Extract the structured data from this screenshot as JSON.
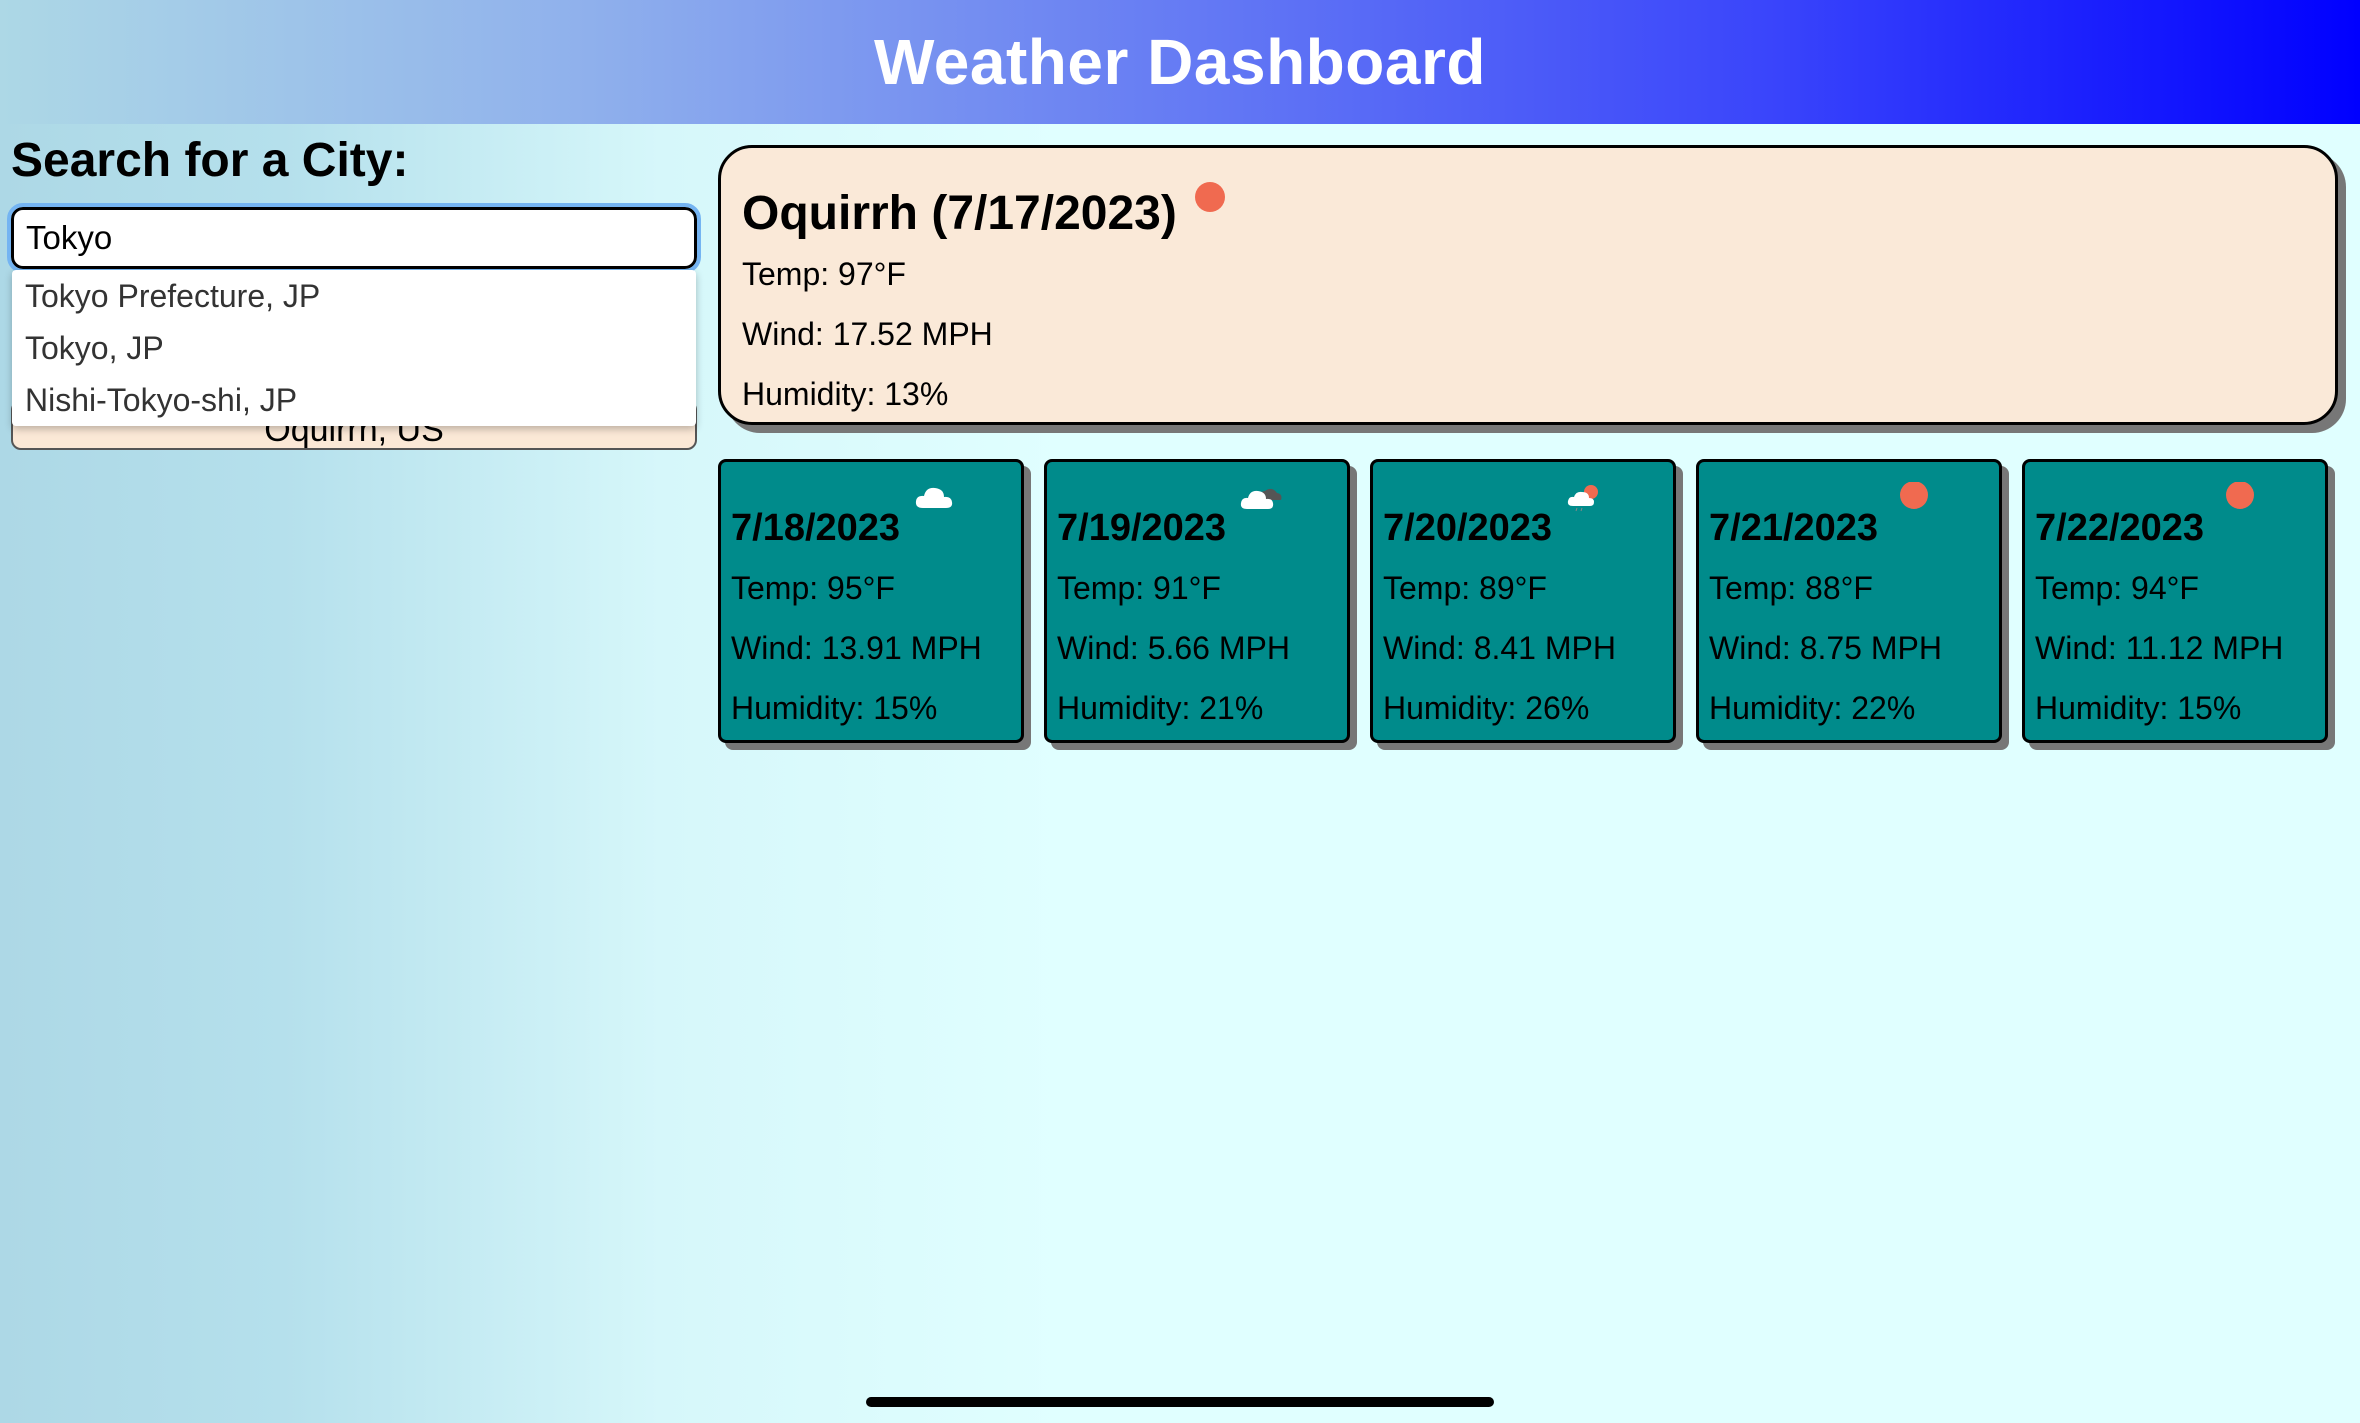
{
  "header": {
    "title": "Weather Dashboard"
  },
  "search": {
    "title": "Search for a City:",
    "input_value": "Tokyo",
    "suggestions": [
      "Tokyo Prefecture, JP",
      "Tokyo, JP",
      "Nishi-Tokyo-shi, JP"
    ],
    "history": [
      "Oquirrh, US"
    ]
  },
  "current": {
    "city_date": "Oquirrh (7/17/2023)",
    "icon": "sun-icon",
    "temp": "Temp: 97°F",
    "wind": "Wind: 17.52 MPH",
    "humidity": "Humidity: 13%"
  },
  "forecast": [
    {
      "date": "7/18/2023",
      "icon": "cloud-icon",
      "temp": "Temp: 95°F",
      "wind": "Wind: 13.91 MPH",
      "humidity": "Humidity: 15%"
    },
    {
      "date": "7/19/2023",
      "icon": "cloudy-icon",
      "temp": "Temp: 91°F",
      "wind": "Wind: 5.66 MPH",
      "humidity": "Humidity: 21%"
    },
    {
      "date": "7/20/2023",
      "icon": "partly-cloudy-icon",
      "temp": "Temp: 89°F",
      "wind": "Wind: 8.41 MPH",
      "humidity": "Humidity: 26%"
    },
    {
      "date": "7/21/2023",
      "icon": "sun-icon",
      "temp": "Temp: 88°F",
      "wind": "Wind: 8.75 MPH",
      "humidity": "Humidity: 22%"
    },
    {
      "date": "7/22/2023",
      "icon": "sun-icon",
      "temp": "Temp: 94°F",
      "wind": "Wind: 11.12 MPH",
      "humidity": "Humidity: 15%"
    }
  ],
  "colors": {
    "current_card_bg": "#fae9d8",
    "forecast_card_bg": "#008b8b",
    "sun": "#f06a50",
    "header_end": "#0000ff"
  }
}
